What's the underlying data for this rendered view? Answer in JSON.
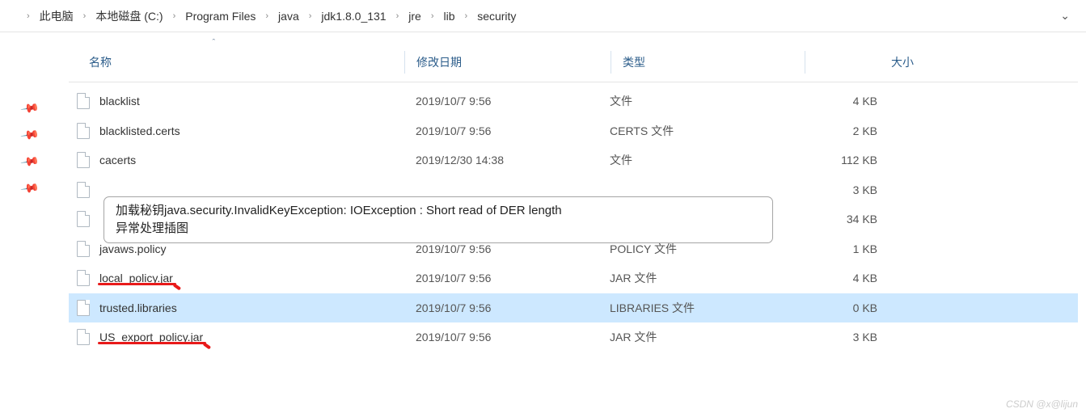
{
  "breadcrumb": {
    "items": [
      "此电脑",
      "本地磁盘 (C:)",
      "Program Files",
      "java",
      "jdk1.8.0_131",
      "jre",
      "lib",
      "security"
    ]
  },
  "columns": {
    "name": "名称",
    "date": "修改日期",
    "type": "类型",
    "size": "大小"
  },
  "files": [
    {
      "name": "blacklist",
      "date": "2019/10/7 9:56",
      "type": "文件",
      "size": "4 KB",
      "underline": false,
      "selected": false
    },
    {
      "name": "blacklisted.certs",
      "date": "2019/10/7 9:56",
      "type": "CERTS 文件",
      "size": "2 KB",
      "underline": false,
      "selected": false
    },
    {
      "name": "cacerts",
      "date": "2019/12/30 14:38",
      "type": "文件",
      "size": "112 KB",
      "underline": false,
      "selected": false
    },
    {
      "name": "",
      "date": "",
      "type": "",
      "size": "3 KB",
      "underline": false,
      "selected": false
    },
    {
      "name": "",
      "date": "",
      "type": "",
      "size": "34 KB",
      "underline": false,
      "selected": false
    },
    {
      "name": "javaws.policy",
      "date": "2019/10/7 9:56",
      "type": "POLICY 文件",
      "size": "1 KB",
      "underline": false,
      "selected": false
    },
    {
      "name": "local_policy.jar",
      "date": "2019/10/7 9:56",
      "type": "JAR 文件",
      "size": "4 KB",
      "underline": true,
      "selected": false
    },
    {
      "name": "trusted.libraries",
      "date": "2019/10/7 9:56",
      "type": "LIBRARIES 文件",
      "size": "0 KB",
      "underline": false,
      "selected": true
    },
    {
      "name": "US_export_policy.jar",
      "date": "2019/10/7 9:56",
      "type": "JAR 文件",
      "size": "3 KB",
      "underline": true,
      "selected": false
    }
  ],
  "tooltip": {
    "line1": "加载秘钥java.security.InvalidKeyException: IOException : Short read of DER length",
    "line2": "异常处理插图"
  },
  "watermark": "CSDN @x@lijun"
}
